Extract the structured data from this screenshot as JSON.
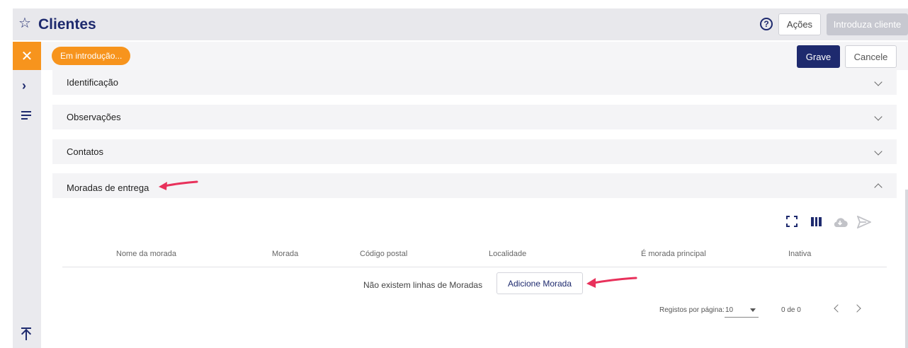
{
  "header": {
    "star_icon": "star-icon",
    "title": "Clientes",
    "help_icon": "help-icon",
    "actions_label": "Ações",
    "introduce_label": "Introduza cliente"
  },
  "sidebar": {
    "close_icon": "close-icon",
    "expand_icon": "chevron-right-icon",
    "list_icon": "list-icon",
    "top_icon": "scroll-top-icon"
  },
  "status": {
    "badge": "Em introdução...",
    "save_label": "Grave",
    "cancel_label": "Cancele"
  },
  "sections": [
    {
      "label": "Identificação",
      "expanded": false
    },
    {
      "label": "Observações",
      "expanded": false
    },
    {
      "label": "Contatos",
      "expanded": false
    },
    {
      "label": "Moradas de entrega",
      "expanded": true
    }
  ],
  "table": {
    "columns": [
      "Nome da morada",
      "Morada",
      "Código postal",
      "Localidade",
      "É morada principal",
      "Inativa"
    ],
    "empty_text": "Não existem linhas de Moradas",
    "add_label": "Adicione Morada"
  },
  "pagination": {
    "rows_label": "Registos por página:",
    "rows_value": "10",
    "count": "0 de 0"
  },
  "colors": {
    "brand": "#1e2a6e",
    "accent": "#f7941d",
    "annotation": "#e8315b"
  }
}
